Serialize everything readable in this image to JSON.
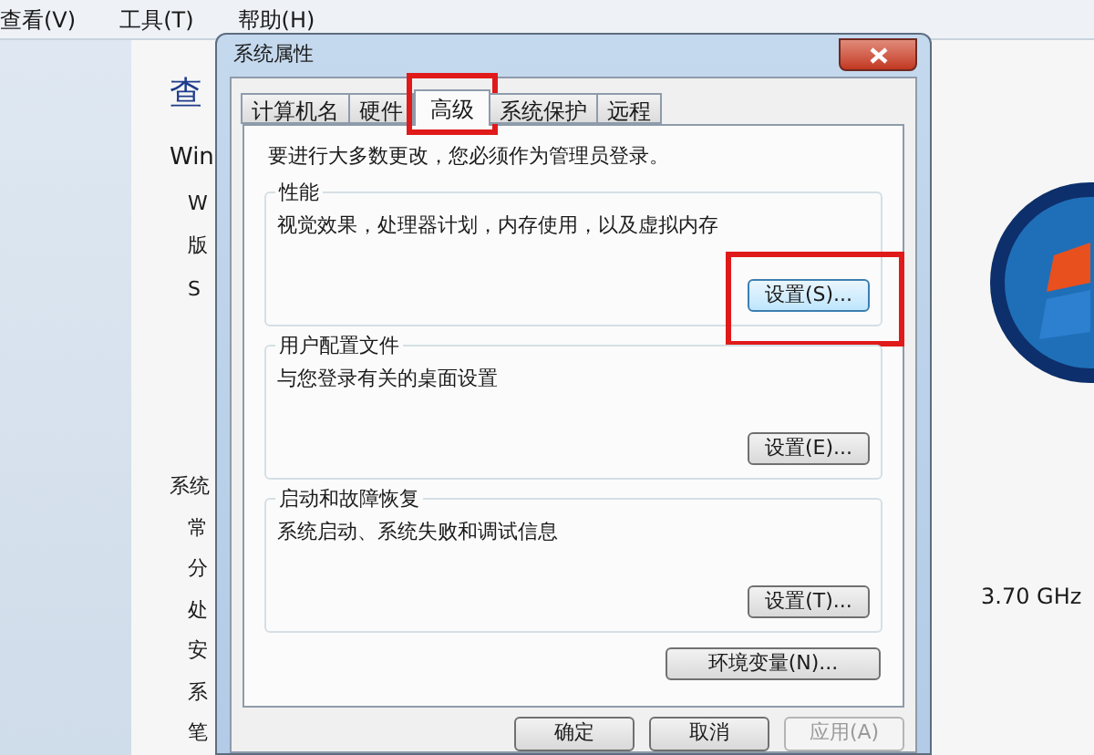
{
  "menu_bar": [
    {
      "label": "查看(V)"
    },
    {
      "label": "工具(T)"
    },
    {
      "label": "帮助(H)"
    }
  ],
  "background_window": {
    "heading": "查",
    "subheading": "Win",
    "lines": [
      "W",
      "版",
      "S"
    ],
    "section": "系统",
    "section_items": [
      "常",
      "分",
      "处",
      "安",
      "系",
      "笔"
    ],
    "processor_speed": "3.70 GHz"
  },
  "dialog": {
    "title": "系统属性",
    "tabs": [
      {
        "label": "计算机名",
        "selected": false,
        "highlighted": false
      },
      {
        "label": "硬件",
        "selected": false,
        "highlighted": false
      },
      {
        "label": "高级",
        "selected": true,
        "highlighted": true
      },
      {
        "label": "系统保护",
        "selected": false,
        "highlighted": false
      },
      {
        "label": "远程",
        "selected": false,
        "highlighted": false
      }
    ],
    "admin_note": "要进行大多数更改，您必须作为管理员登录。",
    "groups": [
      {
        "title": "性能",
        "description": "视觉效果，处理器计划，内存使用，以及虚拟内存",
        "button": {
          "label": "设置(S)...",
          "focused": true,
          "highlighted": true
        }
      },
      {
        "title": "用户配置文件",
        "description": "与您登录有关的桌面设置",
        "button": {
          "label": "设置(E)...",
          "focused": false,
          "highlighted": false
        }
      },
      {
        "title": "启动和故障恢复",
        "description": "系统启动、系统失败和调试信息",
        "button": {
          "label": "设置(T)...",
          "focused": false,
          "highlighted": false
        }
      }
    ],
    "env_button": {
      "label": "环境变量(N)..."
    },
    "buttons": [
      {
        "label": "确定",
        "disabled": false
      },
      {
        "label": "取消",
        "disabled": false
      },
      {
        "label": "应用(A)",
        "disabled": true
      }
    ]
  }
}
